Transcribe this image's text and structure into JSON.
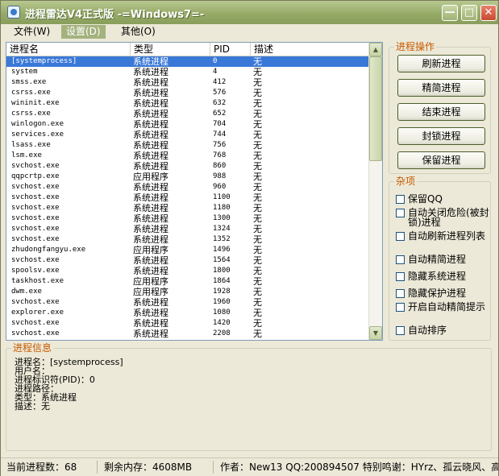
{
  "window": {
    "title": "进程雷达V4正式版 -=Windows7=-"
  },
  "title_buttons": {
    "minimize": "—",
    "maximize": "□",
    "close": "✕"
  },
  "menu": [
    {
      "label": "文件(W)"
    },
    {
      "label": "设置(D)"
    },
    {
      "label": "其他(O)"
    }
  ],
  "process_list": {
    "columns": [
      "进程名",
      "类型",
      "PID",
      "描述"
    ],
    "rows": [
      {
        "name": "[systemprocess]",
        "type": "系统进程",
        "pid": "0",
        "desc": "无"
      },
      {
        "name": "system",
        "type": "系统进程",
        "pid": "4",
        "desc": "无"
      },
      {
        "name": "smss.exe",
        "type": "系统进程",
        "pid": "412",
        "desc": "无"
      },
      {
        "name": "csrss.exe",
        "type": "系统进程",
        "pid": "576",
        "desc": "无"
      },
      {
        "name": "wininit.exe",
        "type": "系统进程",
        "pid": "632",
        "desc": "无"
      },
      {
        "name": "csrss.exe",
        "type": "系统进程",
        "pid": "652",
        "desc": "无"
      },
      {
        "name": "winlogon.exe",
        "type": "系统进程",
        "pid": "704",
        "desc": "无"
      },
      {
        "name": "services.exe",
        "type": "系统进程",
        "pid": "744",
        "desc": "无"
      },
      {
        "name": "lsass.exe",
        "type": "系统进程",
        "pid": "756",
        "desc": "无"
      },
      {
        "name": "lsm.exe",
        "type": "系统进程",
        "pid": "768",
        "desc": "无"
      },
      {
        "name": "svchost.exe",
        "type": "系统进程",
        "pid": "860",
        "desc": "无"
      },
      {
        "name": "qqpcrtp.exe",
        "type": "应用程序",
        "pid": "988",
        "desc": "无"
      },
      {
        "name": "svchost.exe",
        "type": "系统进程",
        "pid": "960",
        "desc": "无"
      },
      {
        "name": "svchost.exe",
        "type": "系统进程",
        "pid": "1100",
        "desc": "无"
      },
      {
        "name": "svchost.exe",
        "type": "系统进程",
        "pid": "1180",
        "desc": "无"
      },
      {
        "name": "svchost.exe",
        "type": "系统进程",
        "pid": "1300",
        "desc": "无"
      },
      {
        "name": "svchost.exe",
        "type": "系统进程",
        "pid": "1324",
        "desc": "无"
      },
      {
        "name": "svchost.exe",
        "type": "系统进程",
        "pid": "1352",
        "desc": "无"
      },
      {
        "name": "zhudongfangyu.exe",
        "type": "应用程序",
        "pid": "1496",
        "desc": "无"
      },
      {
        "name": "svchost.exe",
        "type": "系统进程",
        "pid": "1564",
        "desc": "无"
      },
      {
        "name": "spoolsv.exe",
        "type": "系统进程",
        "pid": "1800",
        "desc": "无"
      },
      {
        "name": "taskhost.exe",
        "type": "应用程序",
        "pid": "1864",
        "desc": "无"
      },
      {
        "name": "dwm.exe",
        "type": "应用程序",
        "pid": "1928",
        "desc": "无"
      },
      {
        "name": "svchost.exe",
        "type": "系统进程",
        "pid": "1960",
        "desc": "无"
      },
      {
        "name": "explorer.exe",
        "type": "系统进程",
        "pid": "1080",
        "desc": "无"
      },
      {
        "name": "svchost.exe",
        "type": "系统进程",
        "pid": "1420",
        "desc": "无"
      },
      {
        "name": "svchost.exe",
        "type": "系统进程",
        "pid": "2208",
        "desc": "无"
      }
    ]
  },
  "process_ops": {
    "title": "进程操作",
    "buttons": [
      "刷新进程",
      "精简进程",
      "结束进程",
      "封锁进程",
      "保留进程"
    ]
  },
  "misc": {
    "title": "杂项",
    "options": [
      "保留QQ",
      "自动关闭危险(被封锁)进程",
      "自动刷新进程列表",
      "自动精简进程",
      "隐藏系统进程",
      "隐藏保护进程",
      "开启自动精简提示",
      "自动排序"
    ]
  },
  "info": {
    "title": "进程信息",
    "lines": [
      "进程名：[systemprocess]",
      "用户名：",
      "进程标识符(PID)：0",
      "进程路径：",
      "类型：系统进程",
      "描述：无"
    ]
  },
  "status": {
    "count": "当前进程数：68",
    "memory": "剩余内存：4608MB",
    "author": "作者：New13 QQ:200894507 特别鸣谢：HYrz、孤云晓风、高"
  },
  "colors": {
    "accent": "#c65a00",
    "selection": "#3a78d8",
    "titlebar": "#97ab68"
  }
}
